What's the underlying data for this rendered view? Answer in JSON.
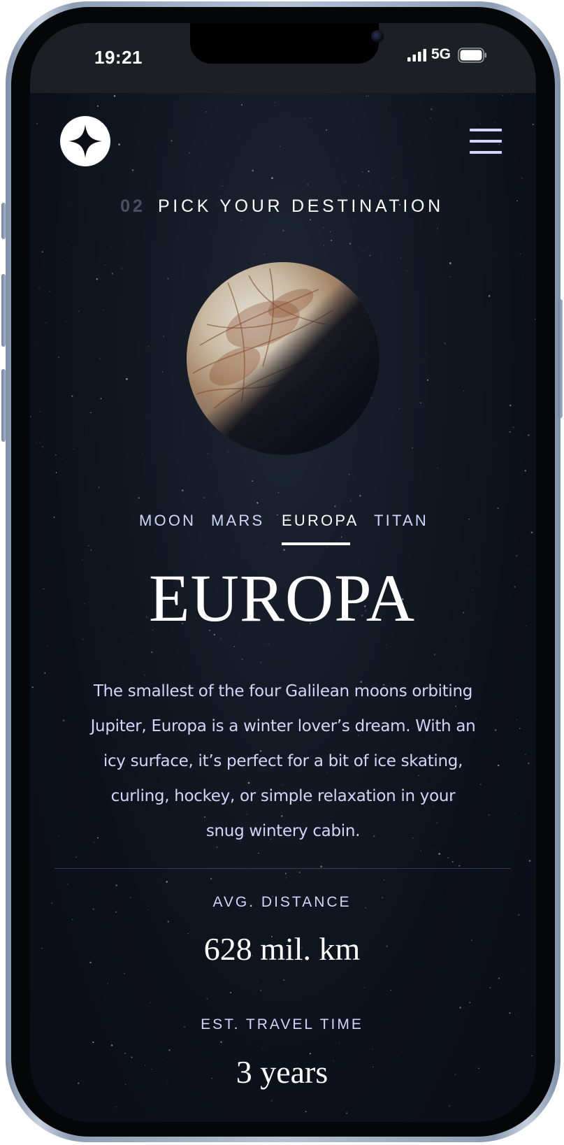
{
  "status_bar": {
    "time": "19:21",
    "network": "5G"
  },
  "header": {
    "logo_icon": "star-logo-icon",
    "menu_icon": "hamburger-menu-icon"
  },
  "page": {
    "number": "02",
    "title": "PICK YOUR DESTINATION"
  },
  "tabs": [
    {
      "label": "MOON",
      "active": false
    },
    {
      "label": "MARS",
      "active": false
    },
    {
      "label": "EUROPA",
      "active": true
    },
    {
      "label": "TITAN",
      "active": false
    }
  ],
  "destination": {
    "name": "EUROPA",
    "description": "The smallest of the four Galilean moons orbiting Jupiter, Europa is a winter lover’s dream. With an icy surface, it’s perfect for a bit of ice skating, curling, hockey, or simple relaxation in your snug wintery cabin.",
    "stats": [
      {
        "label": "AVG. DISTANCE",
        "value": "628 mil. km"
      },
      {
        "label": "EST. TRAVEL TIME",
        "value": "3 years"
      }
    ]
  },
  "colors": {
    "background": "#0b0d17",
    "accent_text": "#d0d6f9",
    "white": "#ffffff",
    "muted_number": "#4a4f63"
  }
}
